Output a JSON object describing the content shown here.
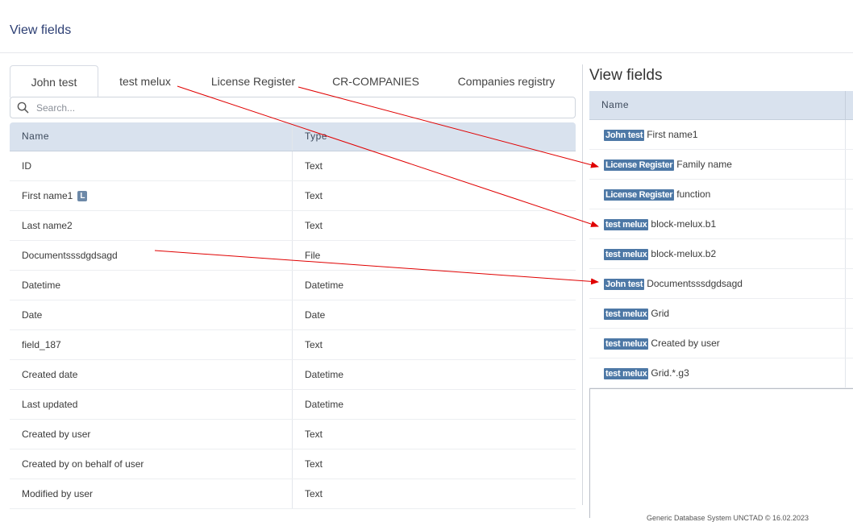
{
  "header": {
    "title": "View fields"
  },
  "tabs": [
    {
      "label": "John test"
    },
    {
      "label": "test melux"
    },
    {
      "label": "License Register"
    },
    {
      "label": "CR-COMPANIES"
    },
    {
      "label": "Companies registry"
    }
  ],
  "search": {
    "placeholder": "Search..."
  },
  "fields_table": {
    "columns": {
      "name": "Name",
      "type": "Type"
    },
    "rows": [
      {
        "name": "ID",
        "type": "Text"
      },
      {
        "name": "First name1",
        "badge": "L",
        "type": "Text"
      },
      {
        "name": "Last name2",
        "type": "Text"
      },
      {
        "name": "Documentsssdgdsagd",
        "type": "File"
      },
      {
        "name": "Datetime",
        "type": "Datetime"
      },
      {
        "name": "Date",
        "type": "Date"
      },
      {
        "name": "field_187",
        "type": "Text"
      },
      {
        "name": "Created date",
        "type": "Datetime"
      },
      {
        "name": "Last updated",
        "type": "Datetime"
      },
      {
        "name": "Created by user",
        "type": "Text"
      },
      {
        "name": "Created by on behalf of user",
        "type": "Text"
      },
      {
        "name": "Modified by user",
        "type": "Text"
      }
    ]
  },
  "view_fields": {
    "title": "View fields",
    "column_name": "Name",
    "rows": [
      {
        "tag": "John test",
        "name": "First name1"
      },
      {
        "tag": "License Register",
        "name": "Family name"
      },
      {
        "tag": "License Register",
        "name": "function"
      },
      {
        "tag": "test melux",
        "name": "block-melux.b1"
      },
      {
        "tag": "test melux",
        "name": "block-melux.b2"
      },
      {
        "tag": "John test",
        "name": "Documentsssdgdsagd"
      },
      {
        "tag": "test melux",
        "name": "Grid"
      },
      {
        "tag": "test melux",
        "name": "Created by user"
      },
      {
        "tag": "test melux",
        "name": "Grid.*.g3"
      }
    ]
  },
  "footer": {
    "text": "Generic Database System UNCTAD © 16.02.2023"
  },
  "colors": {
    "accent_tag": "#4d78a6",
    "header_bg": "#d9e2ee",
    "arrow": "#e00000",
    "title": "#2c3e73"
  }
}
